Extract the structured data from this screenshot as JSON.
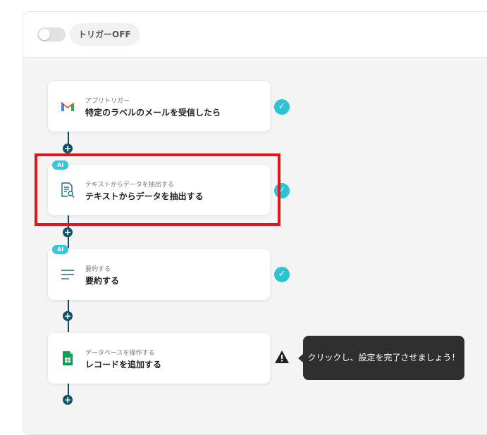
{
  "header": {
    "trigger_label": "トリガーOFF"
  },
  "steps": [
    {
      "subtitle": "アプリトリガー",
      "title": "特定のラベルのメールを受信したら",
      "icon": "gmail-icon",
      "status": "complete"
    },
    {
      "badge": "AI",
      "subtitle": "テキストからデータを抽出する",
      "title": "テキストからデータを抽出する",
      "icon": "document-search-icon",
      "status": "complete"
    },
    {
      "badge": "AI",
      "subtitle": "要約する",
      "title": "要約する",
      "icon": "summarize-lines-icon",
      "status": "complete"
    },
    {
      "subtitle": "データベースを操作する",
      "title": "レコードを追加する",
      "icon": "google-sheets-icon",
      "status": "warning"
    }
  ],
  "tooltip": {
    "text": "クリックし、設定を完了させましょう！"
  },
  "add_step_label": "+",
  "check_glyph": "✓",
  "colors": {
    "connector": "#0e5468",
    "check": "#2ec3d4",
    "ai_badge": "#3cc4d9",
    "highlight": "#e0161b",
    "tooltip_bg": "#2f2f2f"
  }
}
